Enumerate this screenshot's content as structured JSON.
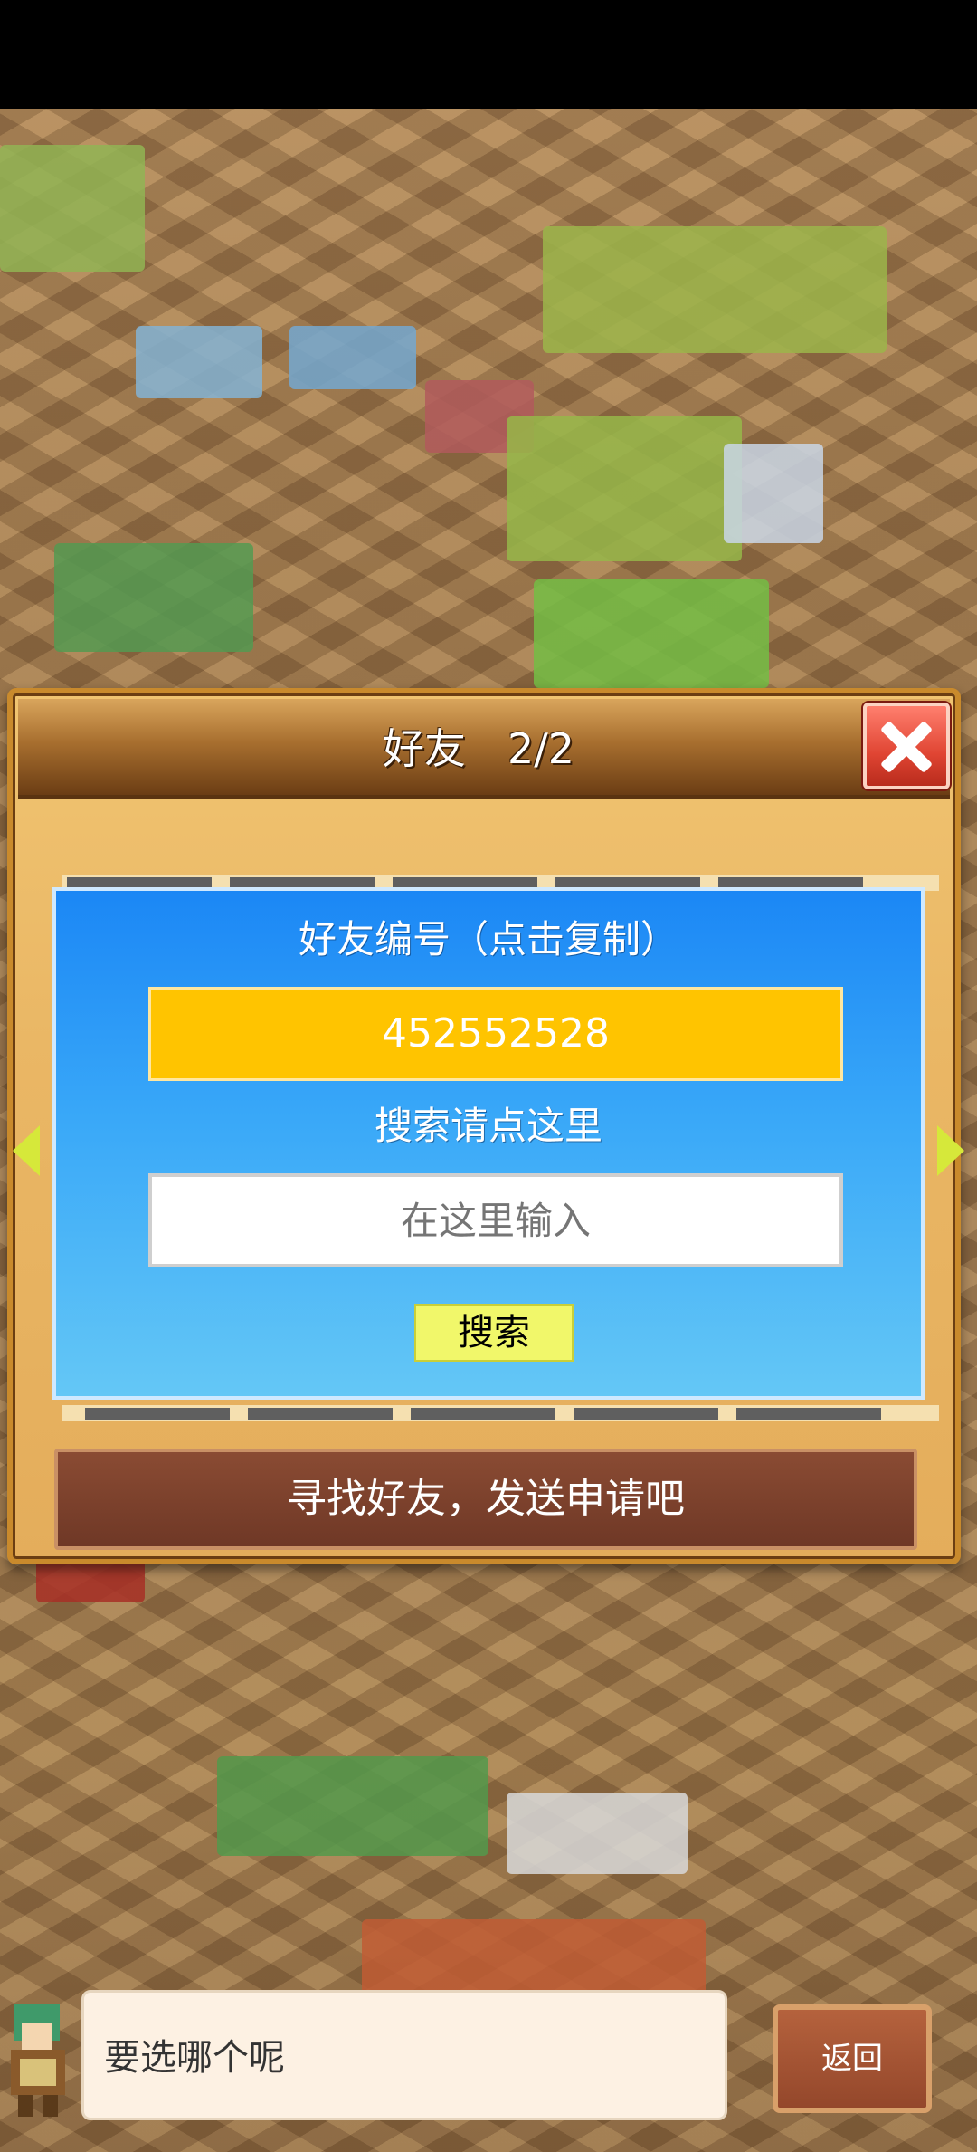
{
  "dialog": {
    "title": "好友　2/2",
    "friend_id_label": "好友编号（点击复制）",
    "friend_id_value": "452552528",
    "search_label": "搜索请点这里",
    "search_placeholder": "在这里输入",
    "search_button": "搜索",
    "find_friends_button": "寻找好友，发送申请吧"
  },
  "bottom_bar": {
    "prompt": "要选哪个呢",
    "back_button": "返回"
  },
  "colors": {
    "panel_blue": "#1b87f5",
    "id_box_yellow": "#ffc400",
    "close_red": "#e04533",
    "find_bar_brown": "#6f3826"
  }
}
